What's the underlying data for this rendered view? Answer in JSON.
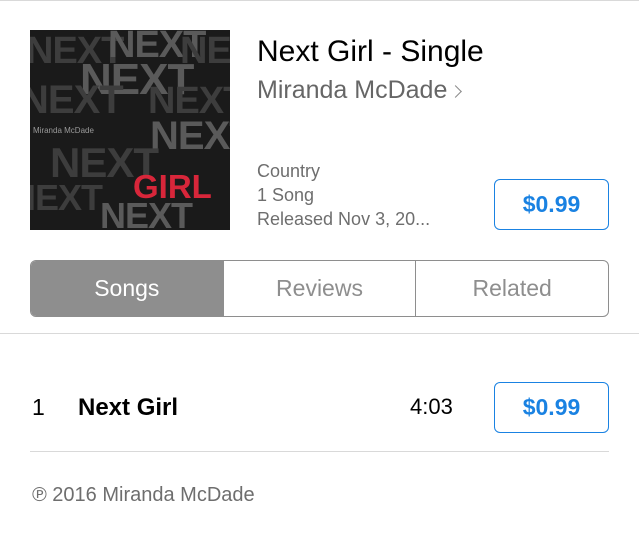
{
  "album": {
    "art_text": {
      "background_word": "NEXT",
      "artist_small": "Miranda McDade",
      "featured_word": "GIRL",
      "featured_color": "#d8263a"
    },
    "title": "Next Girl - Single",
    "artist": "Miranda McDade",
    "genre": "Country",
    "song_count": "1 Song",
    "released": "Released Nov 3, 20...",
    "price": "$0.99"
  },
  "tabs": [
    {
      "label": "Songs",
      "active": true
    },
    {
      "label": "Reviews",
      "active": false
    },
    {
      "label": "Related",
      "active": false
    }
  ],
  "tracks": [
    {
      "number": "1",
      "title": "Next Girl",
      "duration": "4:03",
      "price": "$0.99"
    }
  ],
  "footer": {
    "copyright": "℗ 2016 Miranda McDade"
  },
  "colors": {
    "accent": "#1a82e2",
    "segment_active": "#8e8e8e"
  }
}
